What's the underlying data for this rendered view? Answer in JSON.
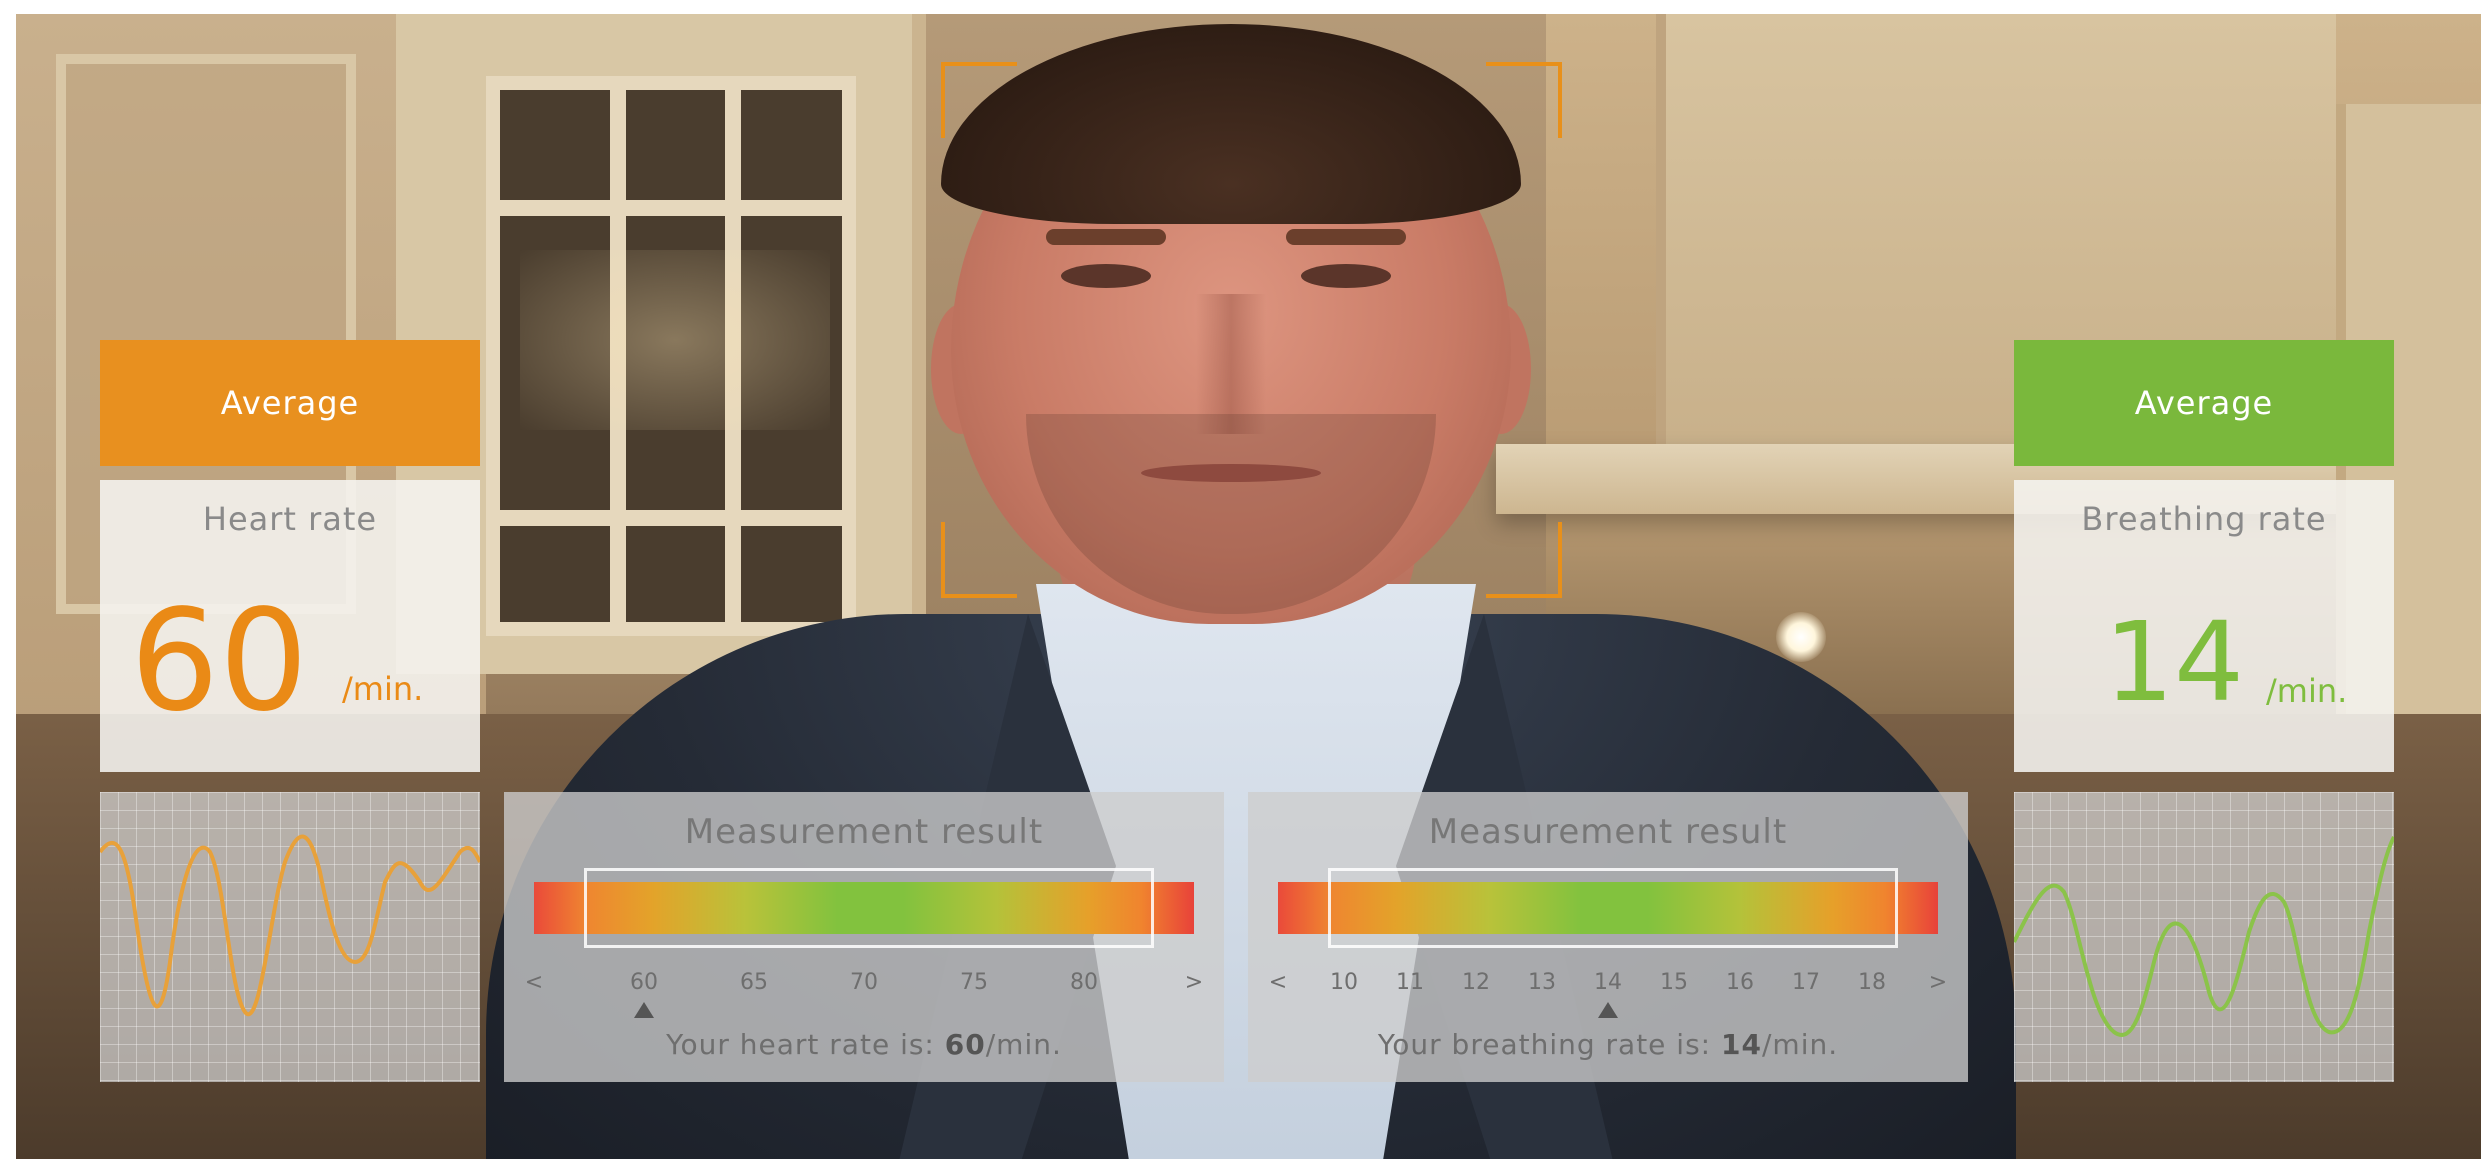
{
  "heart": {
    "badge": "Average",
    "title": "Heart rate",
    "value": "60",
    "unit": "/min.",
    "color": "#ea8a16",
    "result": {
      "title": "Measurement result",
      "ticks": [
        "<",
        "60",
        "65",
        "70",
        "75",
        "80",
        ">"
      ],
      "marker_value": 60,
      "text_prefix": "Your heart rate is:",
      "text_value": "60",
      "text_unit": "/min."
    }
  },
  "breathing": {
    "badge": "Average",
    "title": "Breathing rate",
    "value": "14",
    "unit": "/min.",
    "color": "#7fbd3e",
    "result": {
      "title": "Measurement result",
      "ticks": [
        "<",
        "10",
        "11",
        "12",
        "13",
        "14",
        "15",
        "16",
        "17",
        "18",
        ">"
      ],
      "marker_value": 14,
      "text_prefix": "Your breathing rate is:",
      "text_value": "14",
      "text_unit": "/min."
    }
  },
  "colors": {
    "face_frame": "#e8901a",
    "heart_badge": "#e8901f",
    "breathing_badge": "#7ab83c"
  }
}
